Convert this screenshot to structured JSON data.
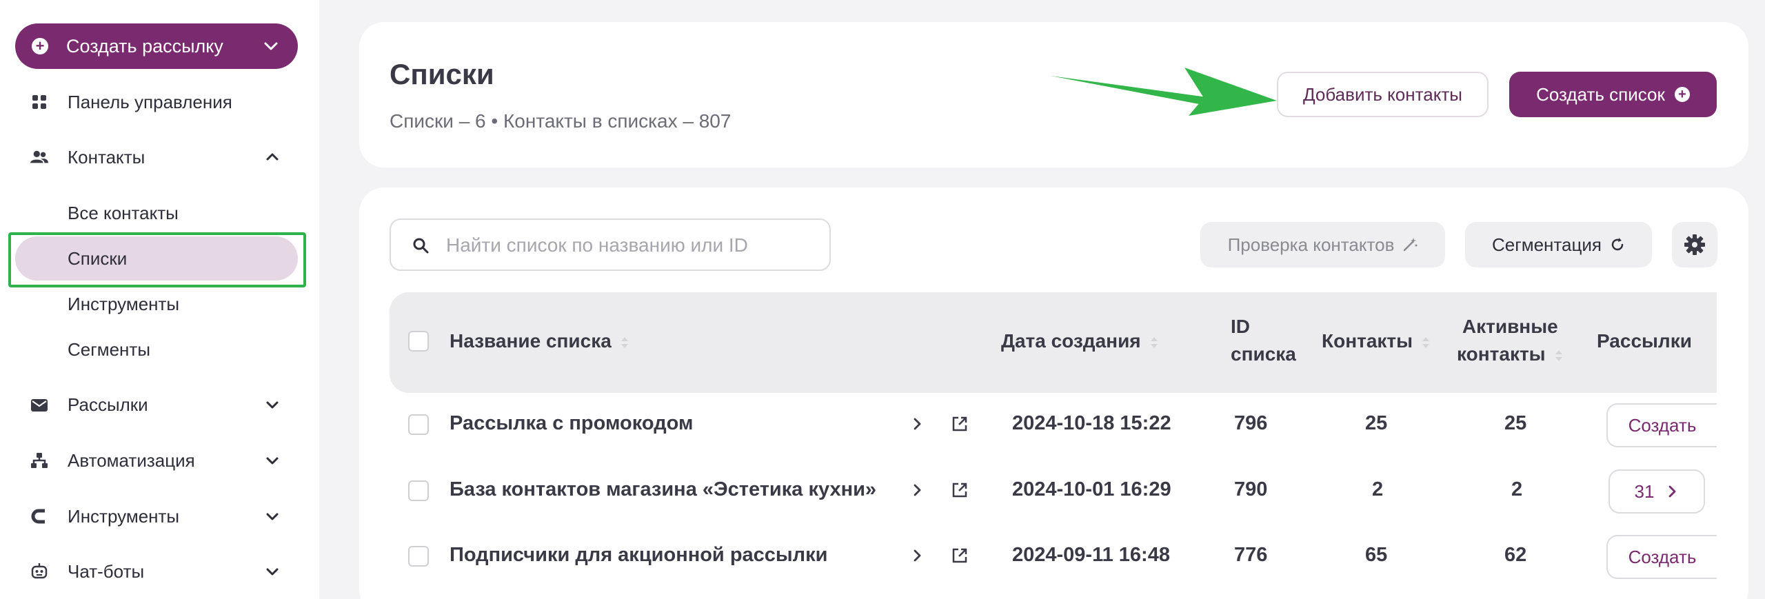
{
  "sidebar": {
    "create_button": "Создать рассылку",
    "items": [
      {
        "label": "Панель управления"
      },
      {
        "label": "Контакты"
      },
      {
        "label": "Рассылки"
      },
      {
        "label": "Автоматизация"
      },
      {
        "label": "Инструменты"
      },
      {
        "label": "Чат-боты"
      }
    ],
    "contacts_sub": [
      {
        "label": "Все контакты"
      },
      {
        "label": "Списки"
      },
      {
        "label": "Инструменты"
      },
      {
        "label": "Сегменты"
      }
    ]
  },
  "header": {
    "title": "Списки",
    "subtitle": "Списки – 6 • Контакты в списках – 807",
    "add_contacts": "Добавить контакты",
    "create_list": "Создать список"
  },
  "toolbar": {
    "search_placeholder": "Найти список по названию или ID",
    "check_contacts": "Проверка контактов",
    "segmentation": "Сегментация"
  },
  "table": {
    "headers": {
      "name": "Название списка",
      "created": "Дата создания",
      "id_line1": "ID",
      "id_line2": "списка",
      "contacts": "Контакты",
      "active_line1": "Активные",
      "active_line2": "контакты",
      "mailings": "Рассылки"
    },
    "rows": [
      {
        "name": "Рассылка с промокодом",
        "created": "2024-10-18 15:22",
        "id": "796",
        "contacts": "25",
        "active": "25",
        "mailings": "Создать"
      },
      {
        "name": "База контактов магазина «Эстетика кухни»",
        "created": "2024-10-01 16:29",
        "id": "790",
        "contacts": "2",
        "active": "2",
        "mailings": "31"
      },
      {
        "name": "Подписчики для акционной рассылки",
        "created": "2024-09-11 16:48",
        "id": "776",
        "contacts": "65",
        "active": "62",
        "mailings": "Создать"
      }
    ]
  },
  "colors": {
    "brand": "#7a2a6e",
    "highlight": "#2fb24c"
  }
}
